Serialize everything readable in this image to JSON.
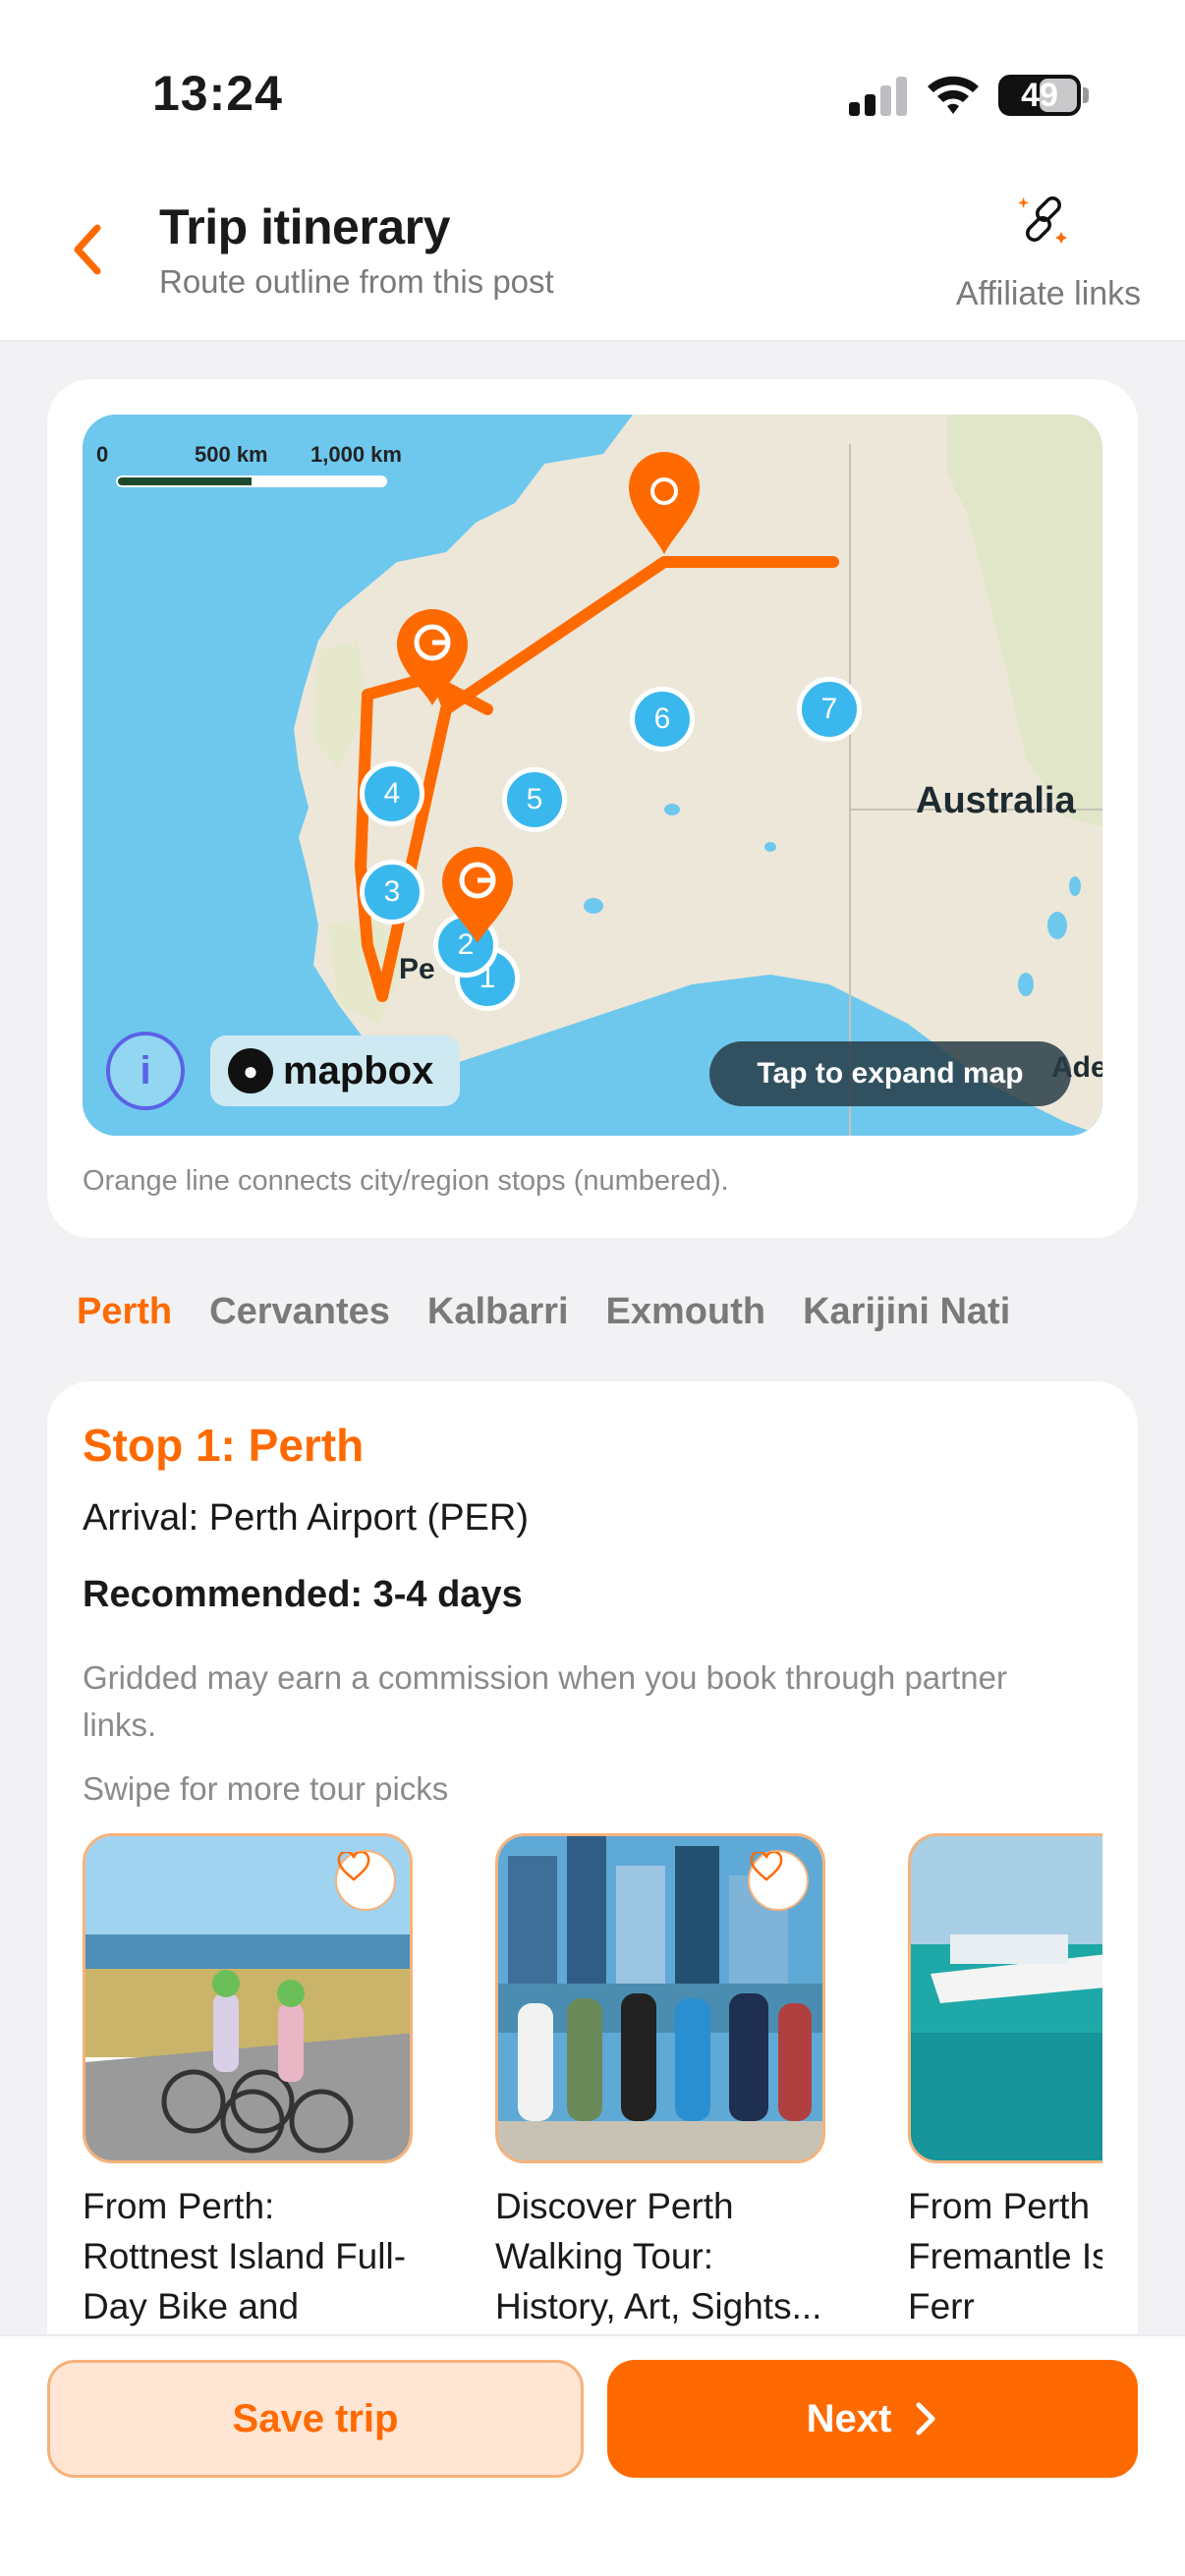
{
  "status_bar": {
    "time": "13:24",
    "battery": "49"
  },
  "header": {
    "title": "Trip itinerary",
    "subtitle": "Route outline from this post",
    "affiliate_label": "Affiliate links"
  },
  "map": {
    "scale_labels": [
      "0",
      "500 km",
      "1,000 km"
    ],
    "country_label": "Australia",
    "partial_label_perth": "Pe",
    "partial_label_adelaide": "Ade",
    "mapbox_label": "mapbox",
    "info_label": "i",
    "expand_label": "Tap to expand map",
    "caption": "Orange line connects city/region stops (numbered).",
    "stops": [
      "1",
      "2",
      "3",
      "4",
      "5",
      "6",
      "7"
    ],
    "colors": {
      "route": "#ff6a00",
      "stop": "#3ab8ee",
      "water": "#6ec8ee",
      "land": "#ece7d9"
    }
  },
  "tabs": [
    "Perth",
    "Cervantes",
    "Kalbarri",
    "Exmouth",
    "Karijini Nati"
  ],
  "active_tab": "Perth",
  "stop": {
    "title": "Stop 1: Perth",
    "arrival": "Arrival: Perth Airport (PER)",
    "recommended": "Recommended: 3-4 days",
    "commission_note": "Gridded may earn a commission when you book through partner links.",
    "swipe_hint": "Swipe for more tour picks",
    "tours": [
      {
        "title": "From Perth: Rottnest Island Full-Day Bike and Ferry..."
      },
      {
        "title": "Discover Perth Walking Tour: History, Art, Sights..."
      },
      {
        "title": "From Perth Fremantle Island Ferr"
      }
    ]
  },
  "actions": {
    "save_label": "Save trip",
    "next_label": "Next"
  },
  "brand_color": "#ff6a00"
}
